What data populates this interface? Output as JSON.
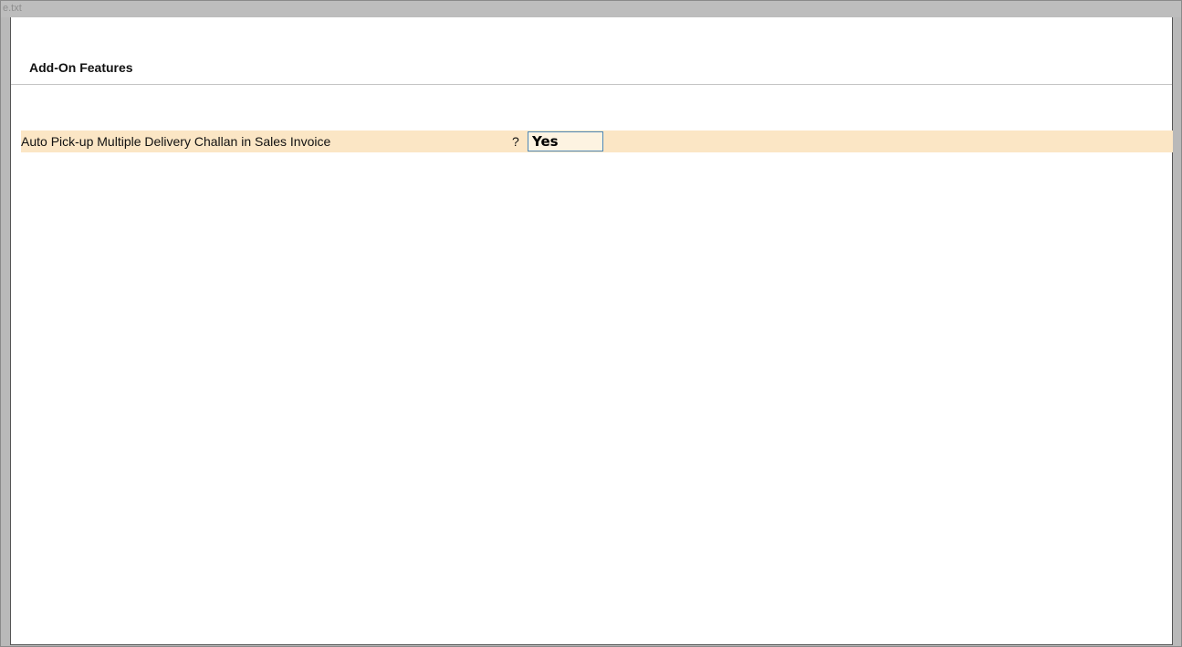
{
  "window": {
    "title": "e.txt"
  },
  "section": {
    "title": "Add-On Features"
  },
  "options": [
    {
      "label": "Auto Pick-up Multiple Delivery Challan in Sales Invoice",
      "question_mark": "?",
      "value": "Yes"
    }
  ],
  "colors": {
    "highlight_row": "#fbe6c5",
    "field_border": "#4d88b8",
    "frame_gray": "#b9b9b9"
  }
}
